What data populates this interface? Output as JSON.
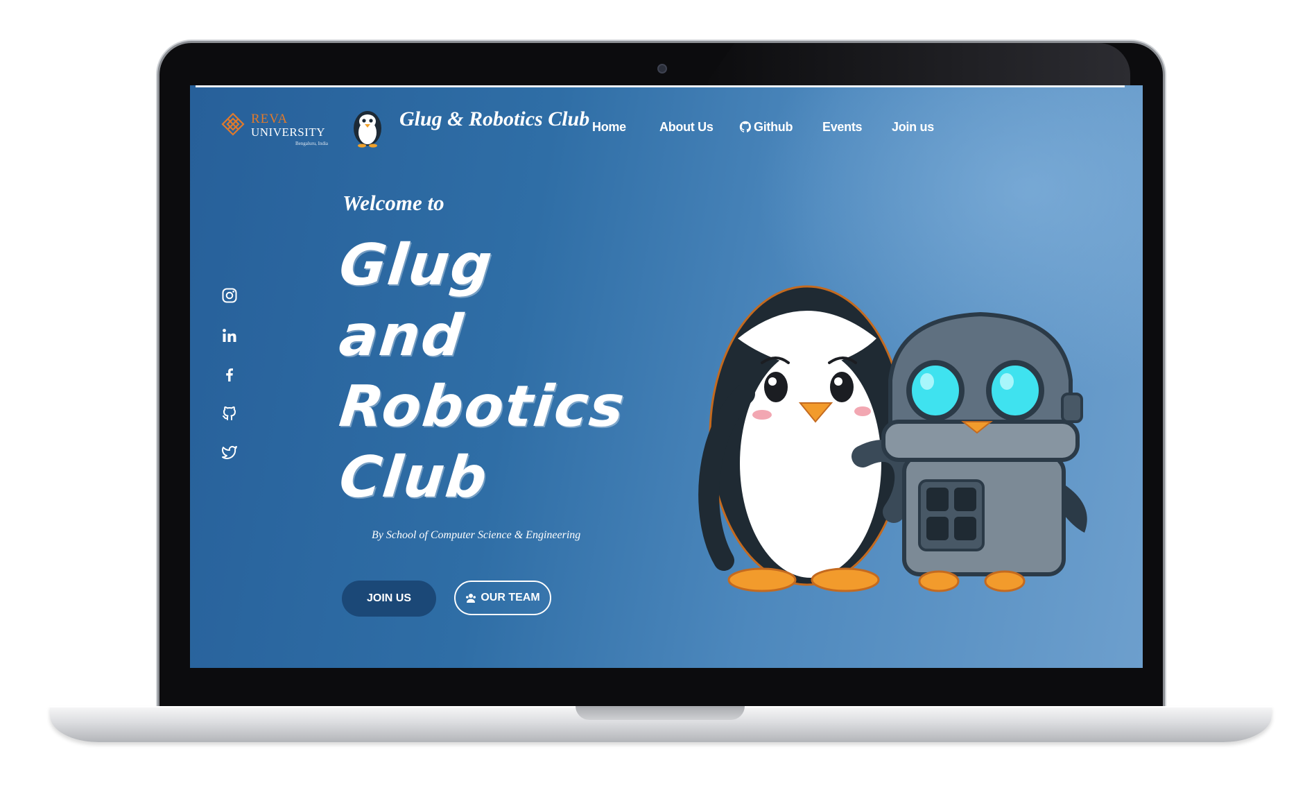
{
  "header": {
    "university_name": "REVA",
    "university_word": "UNIVERSITY",
    "university_city": "Bengaluru, India",
    "site_title": "Glug & Robotics Club"
  },
  "nav": {
    "items": [
      {
        "label": "Home"
      },
      {
        "label": "About Us"
      },
      {
        "label": "Github",
        "icon": "github-icon"
      },
      {
        "label": "Events"
      },
      {
        "label": "Join us"
      }
    ]
  },
  "social": [
    "instagram-icon",
    "linkedin-icon",
    "facebook-icon",
    "github-icon",
    "twitter-icon"
  ],
  "hero": {
    "welcome": "Welcome to",
    "title_lines": [
      "Glug",
      "and",
      "Robotics",
      "Club"
    ],
    "byline": "By School of Computer Science & Engineering",
    "join_button": "JOIN US",
    "team_button": "OUR TEAM"
  },
  "colors": {
    "background_start": "#27609a",
    "background_end": "#6d9fcd",
    "join_button_bg": "#1b4877",
    "reva_orange": "#e07a2c"
  }
}
